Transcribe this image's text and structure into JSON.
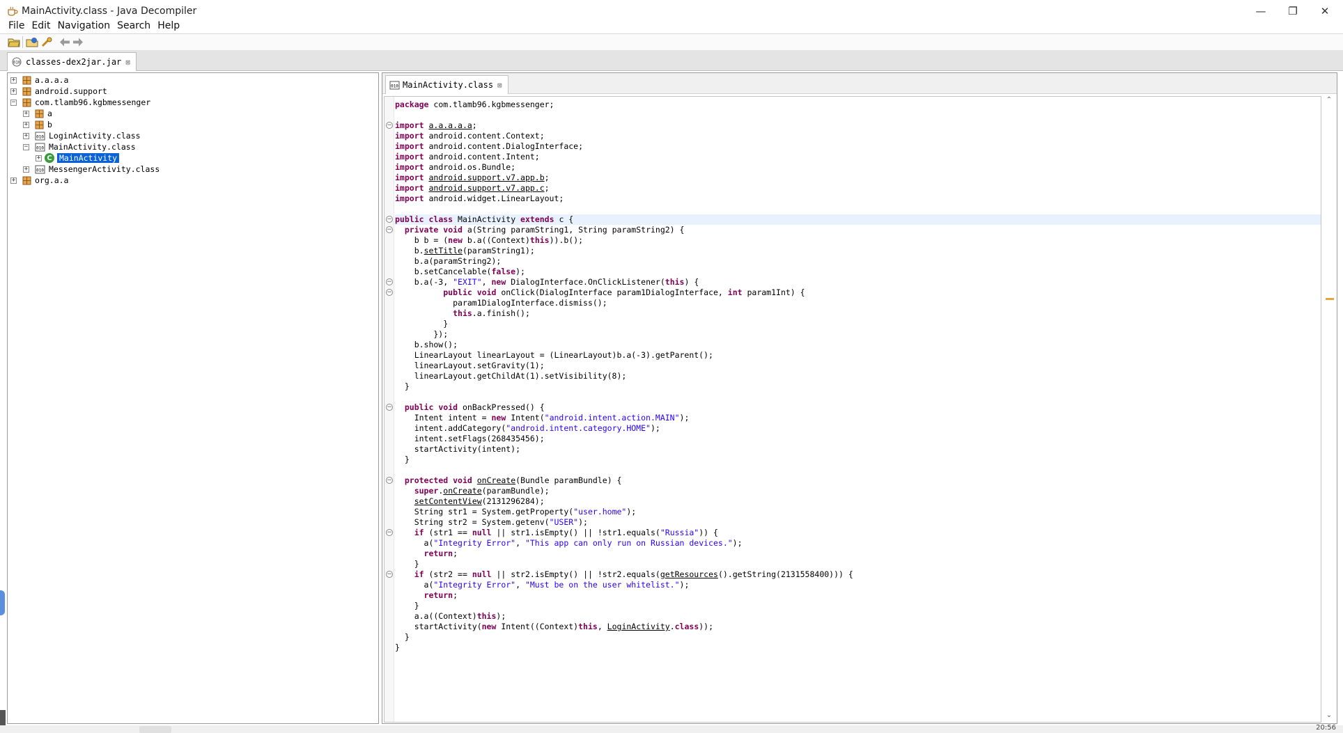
{
  "window": {
    "title": "MainActivity.class - Java Decompiler",
    "controls": {
      "minimize": "—",
      "maximize": "❐",
      "close": "✕"
    }
  },
  "menu": [
    "File",
    "Edit",
    "Navigation",
    "Search",
    "Help"
  ],
  "toolbar": {
    "icons": [
      "open-file-icon",
      "open-type-icon",
      "search-icon",
      "back-arrow-icon",
      "forward-arrow-icon"
    ]
  },
  "file_tab": {
    "label": "classes-dex2jar.jar",
    "close": "⊠"
  },
  "tree": [
    {
      "label": "a.a.a.a",
      "type": "package",
      "expander": "+"
    },
    {
      "label": "android.support",
      "type": "package",
      "expander": "+"
    },
    {
      "label": "com.tlamb96.kgbmessenger",
      "type": "package",
      "expander": "−"
    },
    {
      "label": "a",
      "type": "package",
      "expander": "+"
    },
    {
      "label": "b",
      "type": "package",
      "expander": "+"
    },
    {
      "label": "LoginActivity.class",
      "type": "class",
      "expander": "+"
    },
    {
      "label": "MainActivity.class",
      "type": "class",
      "expander": "−"
    },
    {
      "label": "MainActivity",
      "type": "type",
      "expander": "+",
      "badge": "C"
    },
    {
      "label": "MessengerActivity.class",
      "type": "class",
      "expander": "+"
    },
    {
      "label": "org.a.a",
      "type": "package",
      "expander": "+"
    }
  ],
  "editor": {
    "tab_label": "MainActivity.class",
    "tab_close": "⊠",
    "code": [
      "package com.tlamb96.kgbmessenger;",
      "",
      "import a.a.a.a.a;",
      "import android.content.Context;",
      "import android.content.DialogInterface;",
      "import android.content.Intent;",
      "import android.os.Bundle;",
      "import android.support.v7.app.b;",
      "import android.support.v7.app.c;",
      "import android.widget.LinearLayout;",
      "",
      "public class MainActivity extends c {",
      "  private void a(String paramString1, String paramString2) {",
      "    b b = (new b.a((Context)this)).b();",
      "    b.setTitle(paramString1);",
      "    b.a(paramString2);",
      "    b.setCancelable(false);",
      "    b.a(-3, \"EXIT\", new DialogInterface.OnClickListener(this) {",
      "          public void onClick(DialogInterface param1DialogInterface, int param1Int) {",
      "            param1DialogInterface.dismiss();",
      "            this.a.finish();",
      "          }",
      "        });",
      "    b.show();",
      "    LinearLayout linearLayout = (LinearLayout)b.a(-3).getParent();",
      "    linearLayout.setGravity(1);",
      "    linearLayout.getChildAt(1).setVisibility(8);",
      "  }",
      "",
      "  public void onBackPressed() {",
      "    Intent intent = new Intent(\"android.intent.action.MAIN\");",
      "    intent.addCategory(\"android.intent.category.HOME\");",
      "    intent.setFlags(268435456);",
      "    startActivity(intent);",
      "  }",
      "",
      "  protected void onCreate(Bundle paramBundle) {",
      "    super.onCreate(paramBundle);",
      "    setContentView(2131296284);",
      "    String str1 = System.getProperty(\"user.home\");",
      "    String str2 = System.getenv(\"USER\");",
      "    if (str1 == null || str1.isEmpty() || !str1.equals(\"Russia\")) {",
      "      a(\"Integrity Error\", \"This app can only run on Russian devices.\");",
      "      return;",
      "    }",
      "    if (str2 == null || str2.isEmpty() || !str2.equals(getResources().getString(2131558400))) {",
      "      a(\"Integrity Error\", \"Must be on the user whitelist.\");",
      "      return;",
      "    }",
      "    a.a((Context)this);",
      "    startActivity(new Intent((Context)this, LoginActivity.class));",
      "  }",
      "}"
    ]
  },
  "scrollbar": {
    "up": "⌃",
    "down": "⌄"
  },
  "status": {
    "time": "20:56"
  }
}
